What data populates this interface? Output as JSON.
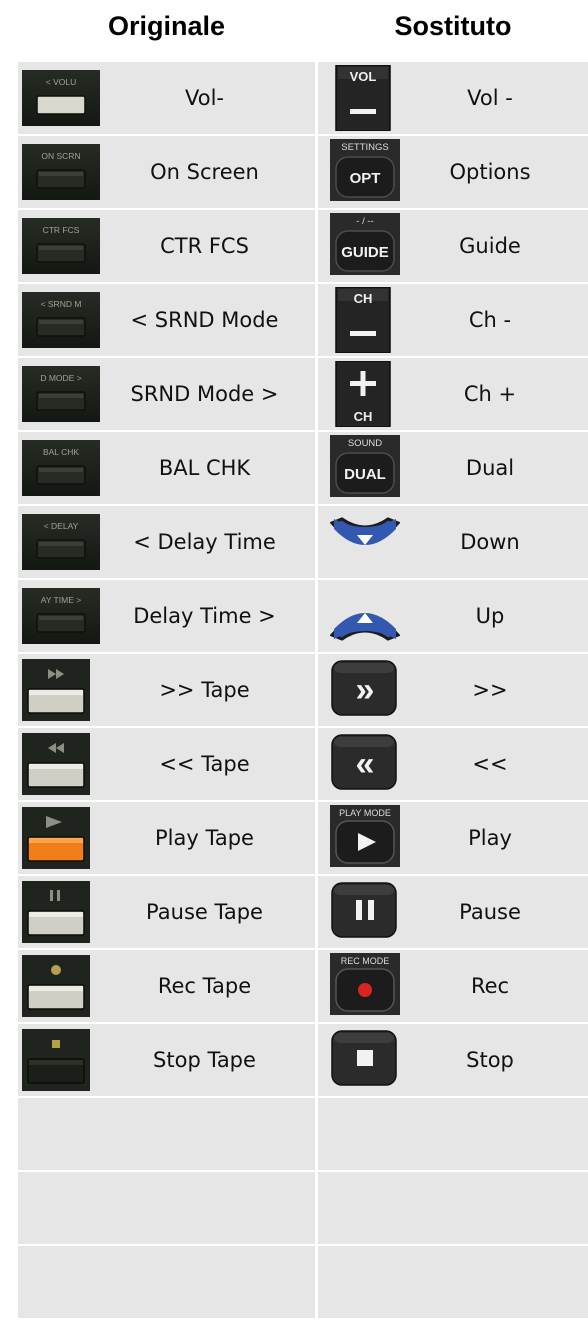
{
  "header": {
    "left": "Originale",
    "right": "Sostituto"
  },
  "rows": [
    {
      "orig_icon": "amp-vol-down-button-icon",
      "orig_img_text": "< VOLU",
      "orig_label": "Vol-",
      "sub_icon": "remote-vol-minus-button-icon",
      "sub_img_text": "VOL",
      "sub_label": "Vol -"
    },
    {
      "orig_icon": "amp-on-screen-button-icon",
      "orig_img_text": "ON SCRN",
      "orig_label": "On Screen",
      "sub_icon": "remote-opt-button-icon",
      "sub_img_text": "SETTINGS",
      "sub_img_text2": "OPT",
      "sub_label": "Options"
    },
    {
      "orig_icon": "amp-ctr-fcs-button-icon",
      "orig_img_text": "CTR FCS",
      "orig_label": "CTR FCS",
      "sub_icon": "remote-guide-button-icon",
      "sub_img_text": "- / --",
      "sub_img_text2": "GUIDE",
      "sub_label": "Guide"
    },
    {
      "orig_icon": "amp-srnd-mode-left-button-icon",
      "orig_img_text": "< SRND M",
      "orig_label": "< SRND Mode",
      "sub_icon": "remote-ch-minus-button-icon",
      "sub_img_text": "CH",
      "sub_label": "Ch -"
    },
    {
      "orig_icon": "amp-srnd-mode-right-button-icon",
      "orig_img_text": "D MODE >",
      "orig_label": "SRND Mode >",
      "sub_icon": "remote-ch-plus-button-icon",
      "sub_img_text": "CH",
      "sub_label": "Ch +"
    },
    {
      "orig_icon": "amp-bal-chk-button-icon",
      "orig_img_text": "BAL CHK",
      "orig_label": "BAL CHK",
      "sub_icon": "remote-dual-button-icon",
      "sub_img_text": "SOUND",
      "sub_img_text2": "DUAL",
      "sub_label": "Dual"
    },
    {
      "orig_icon": "amp-delay-left-button-icon",
      "orig_img_text": "< DELAY",
      "orig_label": "< Delay Time",
      "sub_icon": "remote-down-arrow-button-icon",
      "sub_label": "Down"
    },
    {
      "orig_icon": "amp-delay-right-button-icon",
      "orig_img_text": "AY TIME >",
      "orig_label": "Delay Time >",
      "sub_icon": "remote-up-arrow-button-icon",
      "sub_label": "Up"
    },
    {
      "orig_icon": "amp-fast-forward-button-icon",
      "orig_label": ">> Tape",
      "sub_icon": "remote-fast-forward-button-icon",
      "sub_label": ">>"
    },
    {
      "orig_icon": "amp-rewind-button-icon",
      "orig_label": "<< Tape",
      "sub_icon": "remote-rewind-button-icon",
      "sub_label": "<<"
    },
    {
      "orig_icon": "amp-play-button-icon",
      "orig_label": "Play Tape",
      "sub_icon": "remote-play-button-icon",
      "sub_img_text": "PLAY MODE",
      "sub_label": "Play"
    },
    {
      "orig_icon": "amp-pause-button-icon",
      "orig_label": "Pause Tape",
      "sub_icon": "remote-pause-button-icon",
      "sub_label": "Pause"
    },
    {
      "orig_icon": "amp-rec-button-icon",
      "orig_label": "Rec Tape",
      "sub_icon": "remote-rec-button-icon",
      "sub_img_text": "REC MODE",
      "sub_label": "Rec"
    },
    {
      "orig_icon": "amp-stop-button-icon",
      "orig_label": "Stop Tape",
      "sub_icon": "remote-stop-button-icon",
      "sub_label": "Stop"
    },
    {
      "orig_label": "",
      "sub_label": ""
    },
    {
      "orig_label": "",
      "sub_label": ""
    },
    {
      "orig_label": "",
      "sub_label": ""
    }
  ],
  "colors": {
    "cell_bg": "#e6e6e6",
    "remote_body": "#2b2b2b",
    "amp_body": "#1e231c",
    "arrow_blue": "#3358b0",
    "play_orange": "#f07f1a",
    "rec_red": "#d7261f"
  }
}
